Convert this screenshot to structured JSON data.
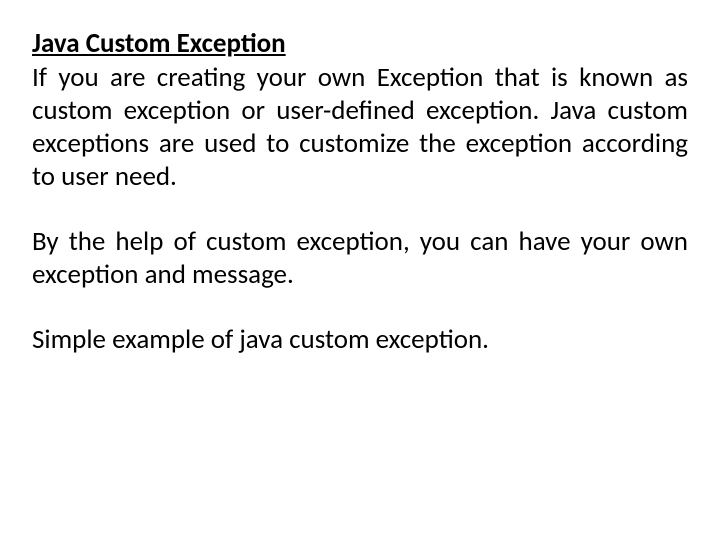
{
  "heading": "Java Custom Exception",
  "paragraph1": "If you are creating your own Exception that is known as custom exception or user-defined exception. Java custom exceptions are used to customize the exception according to user need.",
  "paragraph2": "By the help of custom exception, you can have your own exception and message.",
  "paragraph3": "Simple example of java custom exception."
}
